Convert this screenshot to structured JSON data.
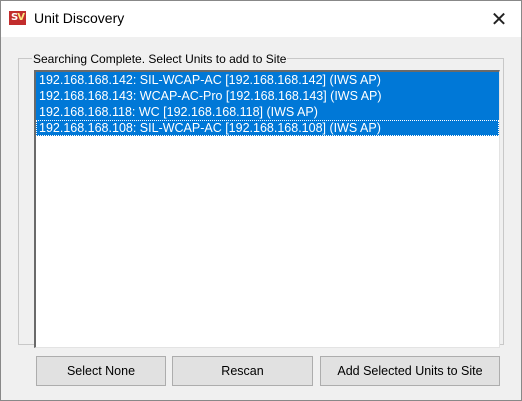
{
  "window": {
    "title": "Unit Discovery",
    "icon_text": "SV",
    "close_glyph": "✕"
  },
  "group": {
    "caption": "Searching Complete. Select Units to add to Site"
  },
  "units": [
    {
      "label": "192.168.168.142: SIL-WCAP-AC [192.168.168.142] (IWS AP)",
      "selected": true
    },
    {
      "label": "192.168.168.143: WCAP-AC-Pro [192.168.168.143] (IWS AP)",
      "selected": true
    },
    {
      "label": "192.168.168.118: WC [192.168.168.118] (IWS AP)",
      "selected": true
    },
    {
      "label": "192.168.168.108: SIL-WCAP-AC [192.168.168.108] (IWS AP)",
      "selected": true
    }
  ],
  "buttons": {
    "select_none": "Select None",
    "rescan": "Rescan",
    "add_selected": "Add Selected Units to Site"
  },
  "colors": {
    "selection": "#0078d7",
    "app_icon": "#c22d2d"
  }
}
